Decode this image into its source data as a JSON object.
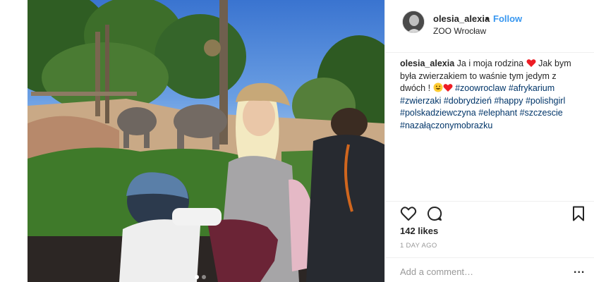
{
  "post": {
    "username": "olesia_alexia",
    "bullet": "•",
    "follow_label": "Follow",
    "location": "ZOO Wrocław"
  },
  "caption": {
    "username": "olesia_alexia",
    "text_part1": "Ja i moja rodzina",
    "text_part2": "Jak bym była zwierzakiem to waśnie tym jedym z dwóch !",
    "hashtags": [
      "#zoowroclaw",
      "#afrykarium",
      "#zwierzaki",
      "#dobrydzień",
      "#happy",
      "#polishgirl",
      "#polskadziewczyna",
      "#elephant",
      "#szczescie",
      "#nazałączonymobrazku"
    ]
  },
  "stats": {
    "likes": "142 likes",
    "time": "1 DAY AGO"
  },
  "comment": {
    "placeholder": "Add a comment…",
    "more_label": "..."
  },
  "icons": {
    "like": "heart-icon",
    "comment": "comment-icon",
    "save": "bookmark-icon",
    "more": "more-icon"
  },
  "colors": {
    "accent": "#3897f0",
    "hashtag": "#003569",
    "heart_emoji": "#ed1c24",
    "border": "#efefef",
    "muted": "#999999"
  },
  "carousel": {
    "dots": 2,
    "active": 1
  }
}
